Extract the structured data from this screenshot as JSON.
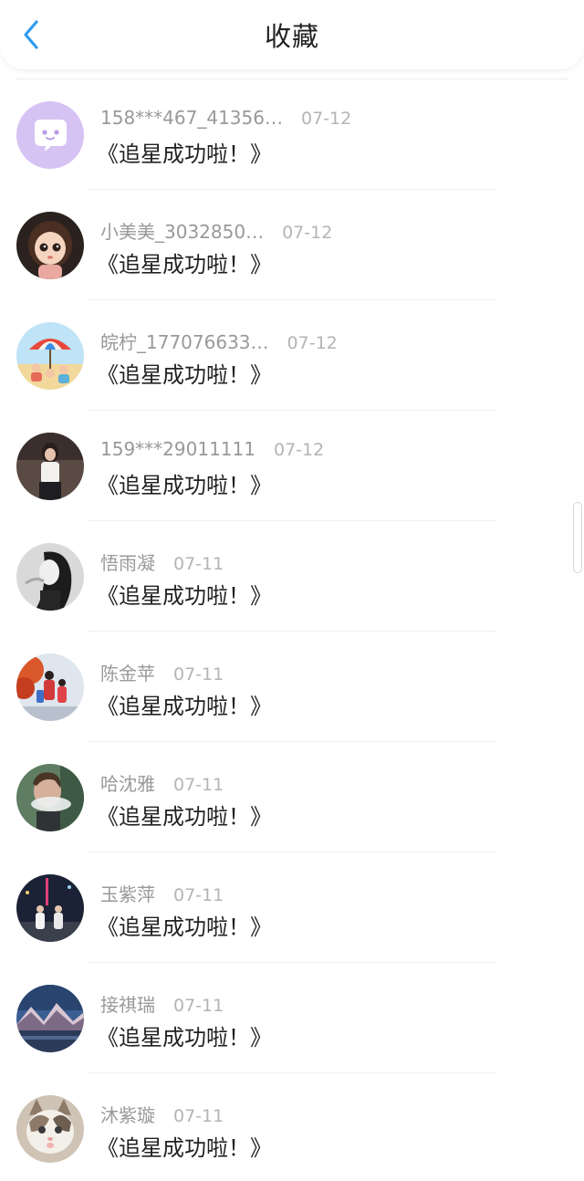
{
  "header": {
    "title": "收藏",
    "back_icon": "chevron-left-icon",
    "accent_color": "#2f9bf0"
  },
  "favorites": [
    {
      "name": "158***467_41356…",
      "date": "07-12",
      "text": "《追星成功啦！》",
      "avatar": "chat-bubble-avatar"
    },
    {
      "name": "小美美_3032850…",
      "date": "07-12",
      "text": "《追星成功啦！》",
      "avatar": "cartoon-girl-avatar"
    },
    {
      "name": "皖柠_177076633…",
      "date": "07-12",
      "text": "《追星成功啦！》",
      "avatar": "beach-umbrella-avatar"
    },
    {
      "name": "159***29011111",
      "date": "07-12",
      "text": "《追星成功啦！》",
      "avatar": "woman-photo-avatar"
    },
    {
      "name": "悟雨凝",
      "date": "07-11",
      "text": "《追星成功啦！》",
      "avatar": "bw-portrait-avatar"
    },
    {
      "name": "陈金苹",
      "date": "07-11",
      "text": "《追星成功啦！》",
      "avatar": "family-autumn-avatar"
    },
    {
      "name": "哈沈雅",
      "date": "07-11",
      "text": "《追星成功啦！》",
      "avatar": "man-smoke-avatar"
    },
    {
      "name": "玉紫萍",
      "date": "07-11",
      "text": "《追星成功啦！》",
      "avatar": "night-city-avatar"
    },
    {
      "name": "接祺瑞",
      "date": "07-11",
      "text": "《追星成功啦！》",
      "avatar": "mountain-lake-avatar"
    },
    {
      "name": "沐紫璇",
      "date": "07-11",
      "text": "《追星成功啦！》",
      "avatar": "kitten-avatar"
    }
  ]
}
